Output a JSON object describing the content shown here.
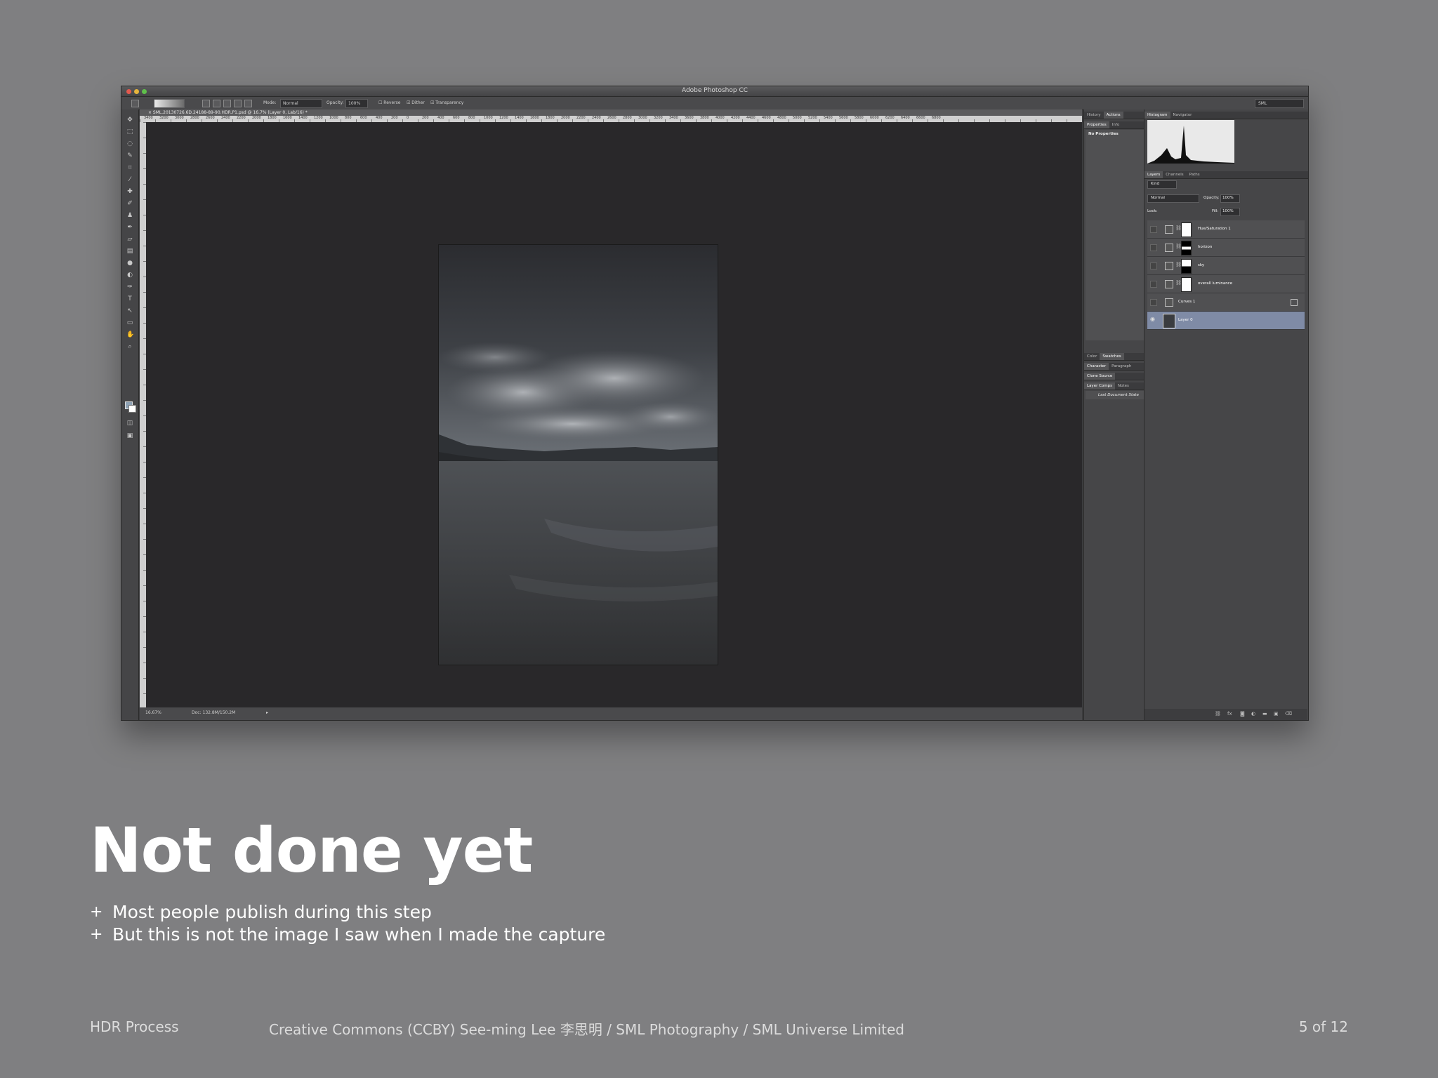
{
  "window": {
    "title": "Adobe Photoshop CC",
    "document_tab": "× SML.20130726.6D.24188-89-90.HDR.P1.psd @ 16.7% (Layer 0, Lab/16) *",
    "workspace": "SML"
  },
  "options_bar": {
    "mode_label": "Mode:",
    "mode_value": "Normal",
    "opacity_label": "Opacity:",
    "opacity_value": "100%",
    "reverse_label": "Reverse",
    "dither_label": "Dither",
    "transparency_label": "Transparency"
  },
  "ruler": {
    "ticks": [
      "3400",
      "3200",
      "3000",
      "2800",
      "2600",
      "2400",
      "2200",
      "2000",
      "1800",
      "1600",
      "1400",
      "1200",
      "1000",
      "800",
      "600",
      "400",
      "200",
      "0",
      "200",
      "400",
      "600",
      "800",
      "1000",
      "1200",
      "1400",
      "1600",
      "1800",
      "2000",
      "2200",
      "2400",
      "2600",
      "2800",
      "3000",
      "3200",
      "3400",
      "3600",
      "3800",
      "4000",
      "4200",
      "4400",
      "4600",
      "4800",
      "5000",
      "5200",
      "5400",
      "5600",
      "5800",
      "6000",
      "6200",
      "6400",
      "6600",
      "6800"
    ]
  },
  "status": {
    "zoom": "16.67%",
    "doc": "Doc: 132.8M/150.2M"
  },
  "panels": {
    "top_tabs": [
      "History",
      "Actions"
    ],
    "properties_tabs": [
      "Properties",
      "Info"
    ],
    "no_properties": "No Properties",
    "color_tabs": [
      "Color",
      "Swatches"
    ],
    "character_tabs": [
      "Character",
      "Paragraph"
    ],
    "clone_source": "Clone Source",
    "layer_comps_tabs": [
      "Layer Comps",
      "Notes"
    ],
    "last_document_state": "Last Document State",
    "histogram_tabs": [
      "Histogram",
      "Navigator"
    ],
    "layers_tabs": [
      "Layers",
      "Channels",
      "Paths"
    ],
    "kind_label": "Kind",
    "blend_mode": "Normal",
    "opacity_label": "Opacity:",
    "opacity_value": "100%",
    "lock_label": "Lock:",
    "fill_label": "Fill:",
    "fill_value": "100%",
    "layers": [
      {
        "name": "Hue/Saturation 1"
      },
      {
        "name": "horizon"
      },
      {
        "name": "sky"
      },
      {
        "name": "overall luminance"
      },
      {
        "name": "Curves 1"
      },
      {
        "name": "Layer 0"
      }
    ]
  },
  "slide": {
    "title": "Not done yet",
    "bullets": [
      "Most people publish during this step",
      "But this is not the image I saw when I made the capture"
    ],
    "bullet_marker": "+",
    "footer_left": "HDR Process",
    "footer_center": "Creative Commons (CCBY) See-ming Lee 李思明 / SML Photography / SML Universe Limited",
    "footer_right": "5 of 12"
  }
}
